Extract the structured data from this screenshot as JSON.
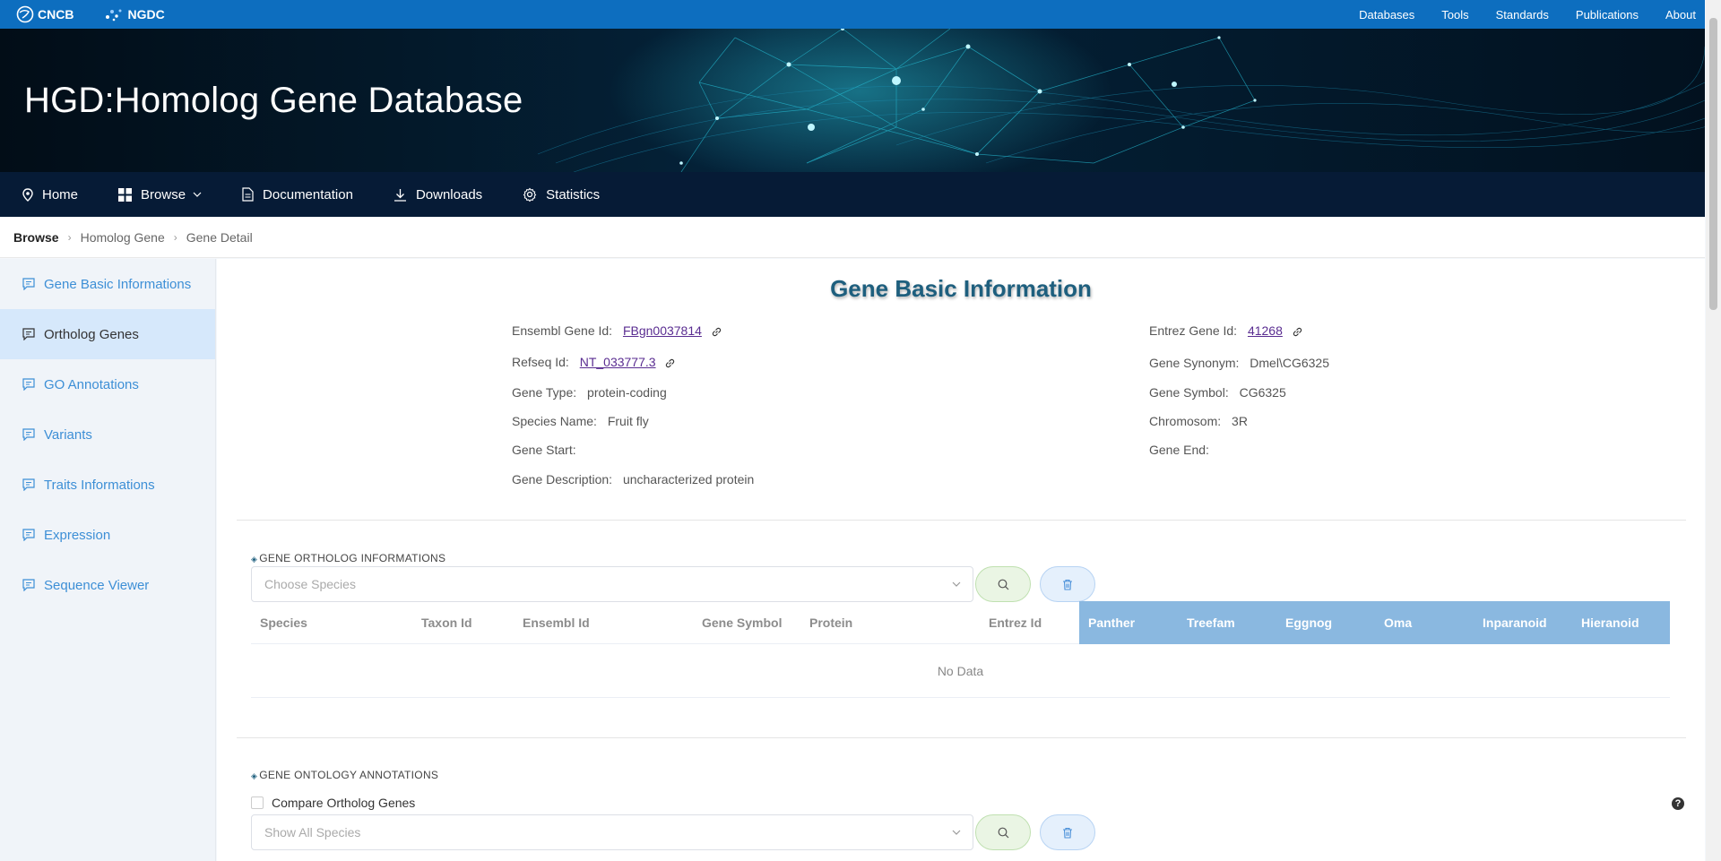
{
  "topbar": {
    "logos": [
      "CNCB",
      "NGDC"
    ],
    "nav": [
      "Databases",
      "Tools",
      "Standards",
      "Publications",
      "About"
    ]
  },
  "banner": {
    "title": "HGD:Homolog Gene Database"
  },
  "nav": {
    "home": "Home",
    "browse": "Browse",
    "documentation": "Documentation",
    "downloads": "Downloads",
    "statistics": "Statistics"
  },
  "breadcrumb": [
    "Browse",
    "Homolog Gene",
    "Gene Detail"
  ],
  "sidebar": {
    "items": [
      {
        "label": "Gene Basic Informations"
      },
      {
        "label": "Ortholog Genes"
      },
      {
        "label": "GO Annotations"
      },
      {
        "label": "Variants"
      },
      {
        "label": "Traits Informations"
      },
      {
        "label": "Expression"
      },
      {
        "label": "Sequence Viewer"
      }
    ],
    "active_index": 1
  },
  "gene": {
    "heading": "Gene Basic Information",
    "ensembl_label": "Ensembl Gene Id:",
    "ensembl_value": "FBgn0037814",
    "entrez_label": "Entrez Gene Id:",
    "entrez_value": "41268",
    "refseq_label": "Refseq Id:",
    "refseq_value": "NT_033777.3",
    "synonym_label": "Gene Synonym:",
    "synonym_value": "Dmel\\CG6325",
    "type_label": "Gene Type:",
    "type_value": "protein-coding",
    "symbol_label": "Gene Symbol:",
    "symbol_value": "CG6325",
    "species_label": "Species Name:",
    "species_value": "Fruit fly",
    "chrom_label": "Chromosom:",
    "chrom_value": "3R",
    "start_label": "Gene Start:",
    "start_value": "",
    "end_label": "Gene End:",
    "end_value": "",
    "desc_label": "Gene Description:",
    "desc_value": "uncharacterized protein"
  },
  "orthologs": {
    "title": "GENE ORTHOLOG INFORMATIONS",
    "select_placeholder": "Choose Species",
    "columns": [
      "Species",
      "Taxon Id",
      "Ensembl Id",
      "Gene Symbol",
      "Protein",
      "Entrez Id",
      "Panther",
      "Treefam",
      "Eggnog",
      "Oma",
      "Inparanoid",
      "Hieranoid"
    ],
    "empty_text": "No Data"
  },
  "go": {
    "title": "GENE ONTOLOGY ANNOTATIONS",
    "compare_label": "Compare Ortholog Genes",
    "select_placeholder": "Show All Species",
    "help": "?"
  },
  "colors": {
    "topbar": "#0d6ebf",
    "navbar": "#061b36",
    "accent_blue": "#3d8fd6",
    "table_header_blue": "#8ab8e0",
    "heading": "#1e5f7e"
  }
}
